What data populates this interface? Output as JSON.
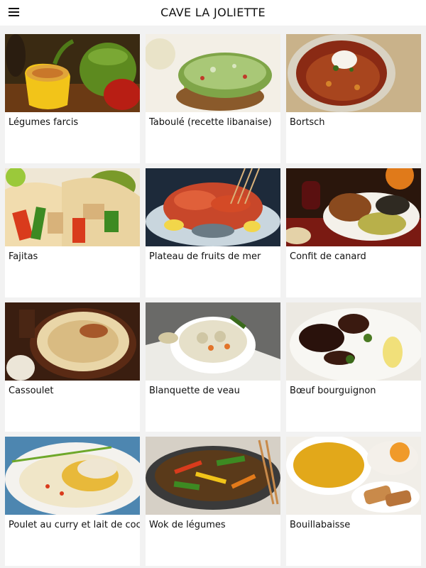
{
  "app": {
    "title": "CAVE LA JOLIETTE",
    "menu_icon": "hamburger-menu-icon"
  },
  "recipes": [
    {
      "label": "Légumes farcis"
    },
    {
      "label": "Taboulé (recette libanaise)"
    },
    {
      "label": "Bortsch"
    },
    {
      "label": "Fajitas"
    },
    {
      "label": "Plateau de fruits de mer"
    },
    {
      "label": "Confit de canard"
    },
    {
      "label": "Cassoulet"
    },
    {
      "label": "Blanquette de veau"
    },
    {
      "label": "Bœuf bourguignon"
    },
    {
      "label": "Poulet au curry et lait de coco"
    },
    {
      "label": "Wok de légumes"
    },
    {
      "label": "Bouillabaisse"
    }
  ]
}
